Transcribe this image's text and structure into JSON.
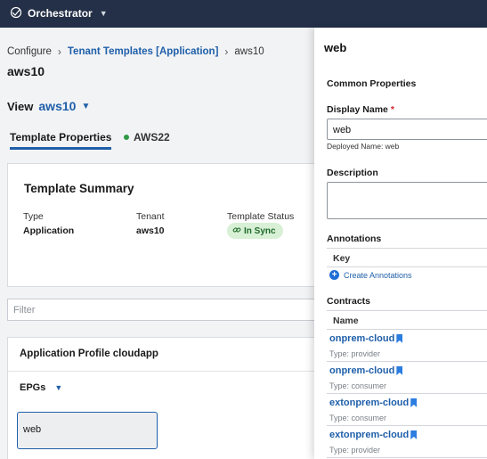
{
  "topbar": {
    "app_name": "Orchestrator",
    "logo_icon": "tech-logo-icon",
    "chevron": "chevron-down-icon"
  },
  "breadcrumb": {
    "items": [
      "Configure",
      "Tenant Templates [Application]",
      "aws10"
    ]
  },
  "page_title": "aws10",
  "view": {
    "label": "View",
    "value": "aws10"
  },
  "tabs": [
    {
      "label": "Template Properties",
      "active": true
    },
    {
      "label": "AWS22",
      "status_color": "#2f9a46"
    }
  ],
  "summary": {
    "title": "Template Summary",
    "type_label": "Type",
    "type_value": "Application",
    "tenant_label": "Tenant",
    "tenant_value": "aws10",
    "status_label": "Template Status",
    "status_value": "In Sync",
    "status_icon": "link-icon"
  },
  "filter": {
    "placeholder": "Filter"
  },
  "app_profile": {
    "title": "Application Profile cloudapp",
    "epgs_label": "EPGs",
    "epg_item": "web"
  },
  "panel": {
    "title": "web",
    "common_properties": "Common Properties",
    "display_name_label": "Display Name",
    "required_mark": "*",
    "display_name_value": "web",
    "deployed_name": "Deployed Name: web",
    "description_label": "Description",
    "description_value": "",
    "annotations_label": "Annotations",
    "annotations_key_header": "Key",
    "create_annotations": "Create Annotations",
    "contracts_label": "Contracts",
    "contracts_name_header": "Name",
    "contracts": [
      {
        "name": "onprem-cloud",
        "type": "Type: provider"
      },
      {
        "name": "onprem-cloud",
        "type": "Type: consumer"
      },
      {
        "name": "extonprem-cloud",
        "type": "Type: consumer"
      },
      {
        "name": "extonprem-cloud",
        "type": "Type: provider"
      }
    ]
  },
  "colors": {
    "accent": "#1f5fa9",
    "topbar": "#243047",
    "sync_bg": "#d8f0d5",
    "sync_text": "#1f6b2c"
  }
}
